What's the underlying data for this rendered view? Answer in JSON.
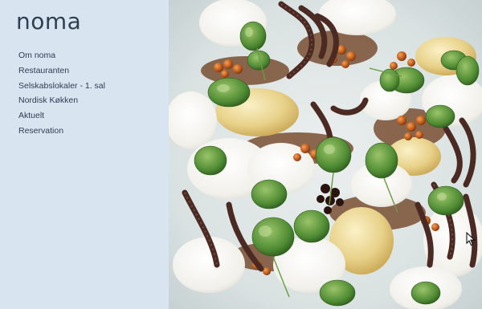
{
  "brand": {
    "logo_text": "noma"
  },
  "nav": {
    "items": [
      {
        "label": "Om noma"
      },
      {
        "label": "Restauranten"
      },
      {
        "label": "Selskabslokaler - 1. sal"
      },
      {
        "label": "Nordisk Køkken"
      },
      {
        "label": "Aktuelt"
      },
      {
        "label": "Reservation"
      }
    ]
  },
  "hero": {
    "image_subject": "food-dish-photo"
  },
  "colors": {
    "sidebar_bg": "#d8e4ef",
    "text": "#2d3d52"
  }
}
